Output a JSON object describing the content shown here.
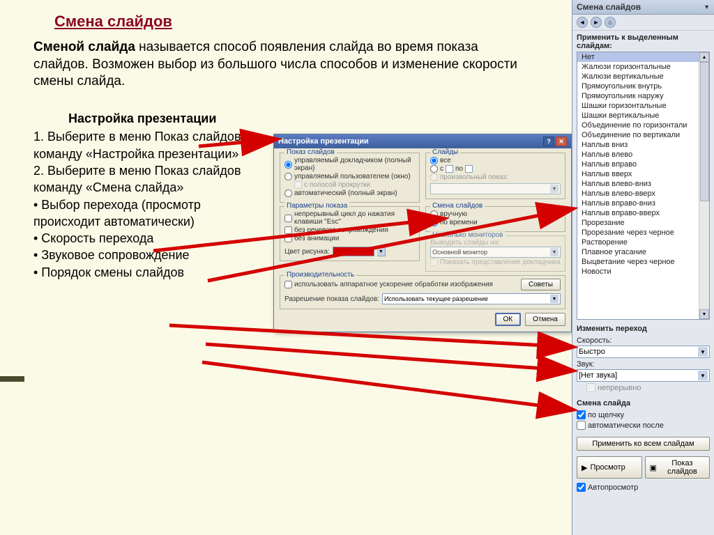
{
  "page": {
    "title": "Смена слайдов",
    "intro_bold": "Сменой слайда",
    "intro_rest": " называется способ появления слайда во время показа слайдов. Возможен выбор из большого числа способов и изменение скорости смены слайда."
  },
  "instructions": {
    "subhead": "Настройка презентации",
    "line1": "1. Выберите в меню Показ слайдов команду «Настройка презентации»",
    "line2": "2. Выберите в меню Показ слайдов команду «Смена слайда»",
    "b1": "• Выбор перехода (просмотр происходит автоматически)",
    "b2": "• Скорость перехода",
    "b3": "• Звуковое сопровождение",
    "b4": "• Порядок смены слайдов"
  },
  "dialog": {
    "title": "Настройка презентации",
    "show_type_legend": "Показ слайдов",
    "r_presenter": "управляемый докладчиком (полный экран)",
    "r_user": "управляемый пользователем (окно)",
    "c_scrollbar": "с полосой прокрутки",
    "r_kiosk": "автоматический (полный экран)",
    "slides_legend": "Слайды",
    "r_all": "все",
    "r_from": "с",
    "r_to": "по",
    "r_custom": "произвольный показ:",
    "options_legend": "Параметры показа",
    "c_loop": "непрерывный цикл до нажатия клавиши \"Esc\"",
    "c_narration": "без речевого сопровождения",
    "c_animation": "без анимации",
    "pen_label": "Цвет рисунка:",
    "advance_legend": "Смена слайдов",
    "r_manual": "вручную",
    "r_timing": "по времени",
    "monitors_legend": "Несколько мониторов",
    "monitor_label": "Выводить слайды на:",
    "monitor_value": "Основной монитор",
    "c_presenter_view": "Показать представление докладчика",
    "perf_legend": "Производительность",
    "c_hardware": "использовать аппаратное ускорение обработки изображения",
    "tips_btn": "Советы",
    "res_label": "Разрешение показа слайдов:",
    "res_value": "Использовать текущее разрешение",
    "ok": "ОК",
    "cancel": "Отмена"
  },
  "taskpane": {
    "header": "Смена слайдов",
    "apply_label": "Применить к выделенным слайдам:",
    "items": [
      "Нет",
      "Жалюзи горизонтальные",
      "Жалюзи вертикальные",
      "Прямоугольник внутрь",
      "Прямоугольник наружу",
      "Шашки горизонтальные",
      "Шашки вертикальные",
      "Объединение по горизонтали",
      "Объединение по вертикали",
      "Наплыв вниз",
      "Наплыв влево",
      "Наплыв вправо",
      "Наплыв вверх",
      "Наплыв влево-вниз",
      "Наплыв влево-вверх",
      "Наплыв вправо-вниз",
      "Наплыв вправо-вверх",
      "Прорезание",
      "Прорезание через черное",
      "Растворение",
      "Плавное угасание",
      "Выцветание через черное",
      "Новости"
    ],
    "modify_label": "Изменить переход",
    "speed_label": "Скорость:",
    "speed_value": "Быстро",
    "sound_label": "Звук:",
    "sound_value": "[Нет звука]",
    "loop_sound": "непрерывно",
    "advance_label": "Смена слайда",
    "on_click": "по щелчку",
    "auto_after": "автоматически после",
    "apply_all": "Применить ко всем слайдам",
    "play": "Просмотр",
    "slideshow": "Показ слайдов",
    "autopreview": "Автопросмотр"
  }
}
